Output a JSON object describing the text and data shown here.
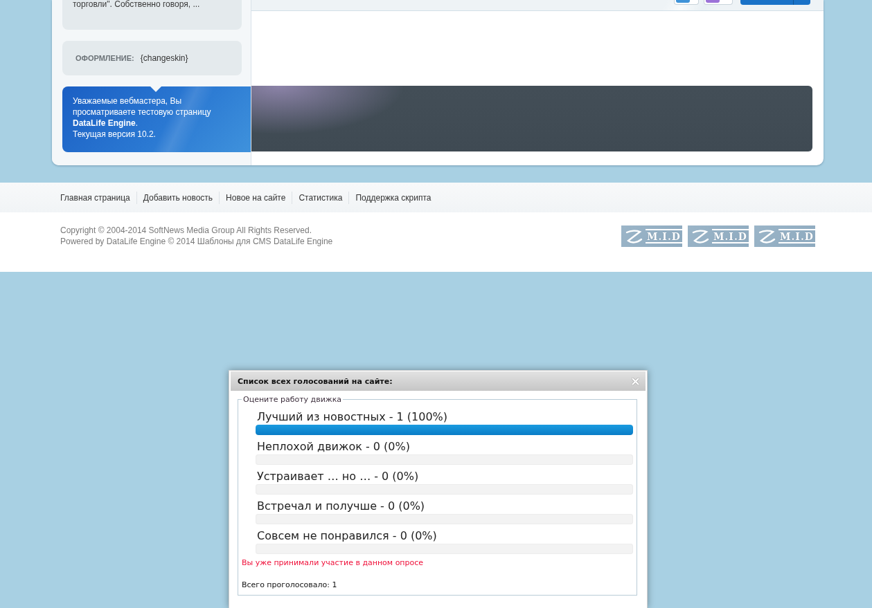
{
  "sidebar": {
    "news_excerpt": "торговли\". Собственно говоря, ...",
    "skin_block": {
      "label": "ОФОРМЛЕНИЕ:",
      "value": "{changeskin}"
    },
    "notice": {
      "text": "Уважаемые вебмастера, Вы просматриваете тестовую страницу **DataLife Engine**.",
      "version": "Текущая версия 10.2."
    }
  },
  "footer_nav": [
    "Главная страница",
    "Добавить новость",
    "Новое на сайте",
    "Статистика",
    "Поддержка скрипта"
  ],
  "footer": {
    "copyright": [
      "Copyright © 2004-2014 SoftNews Media Group All Rights Reserved.",
      "Powered by DataLife Engine © 2014 Шаблоны для CMS DataLife Engine"
    ],
    "badges": [
      {
        "label": "M.I.D"
      },
      {
        "label": "M.I.D"
      },
      {
        "label": "M.I.D"
      }
    ]
  },
  "poll_dialog": {
    "title": "Список всех голосований на сайте:",
    "question": "Оцените работу движка",
    "options": [
      {
        "label": "Лучший из новостных - 1 (100%)",
        "level": 1
      },
      {
        "label": "Неплохой движок - 0 (0%)",
        "level": 0
      },
      {
        "label": "Устраивает … но … - 0 (0%)",
        "level": 0
      },
      {
        "label": "Встречал и получше - 0 (0%)",
        "level": 0
      },
      {
        "label": "Совсем не понравился - 0 (0%)",
        "level": 0
      }
    ],
    "message": "Вы уже принимали участие в данном опросе",
    "total": "Всего проголосовало: 1"
  }
}
